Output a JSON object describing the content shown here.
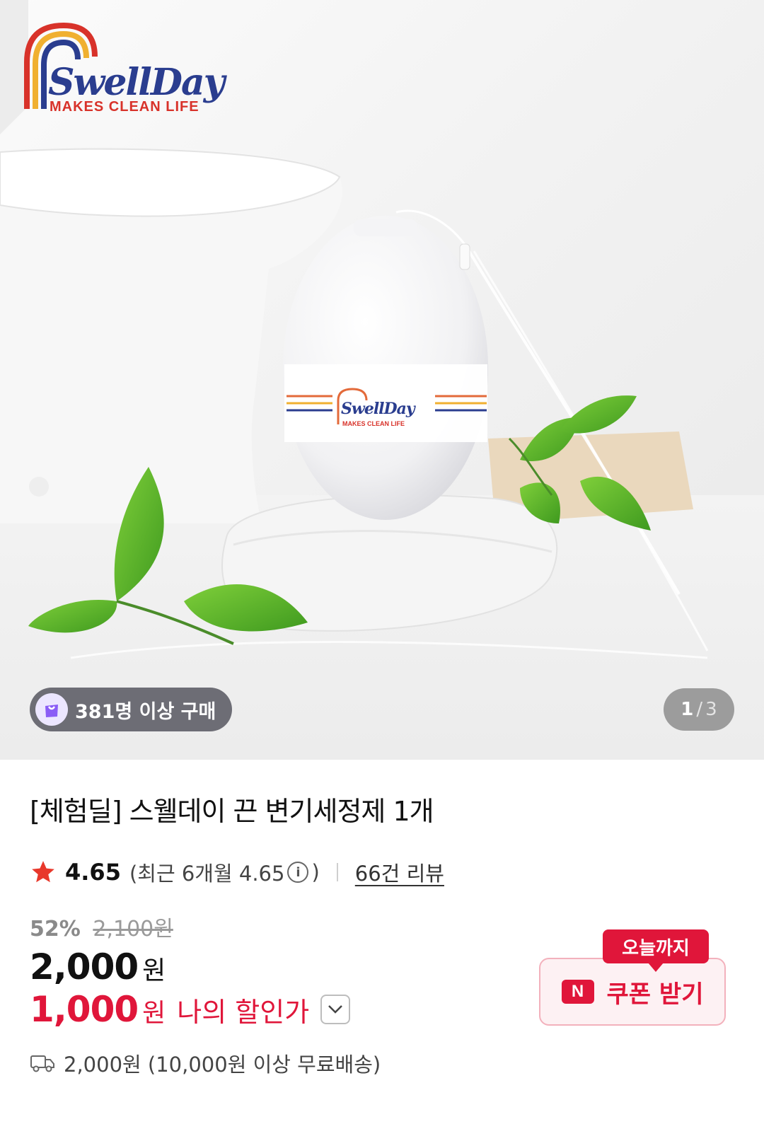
{
  "hero": {
    "logo": {
      "wordmark": "SwellDay",
      "tagline": "MAKES CLEAN LIFE"
    },
    "product_label": {
      "wordmark": "SwellDay",
      "tagline": "MAKES CLEAN LIFE"
    },
    "buyers_badge": "381명 이상 구매",
    "pager": {
      "current": "1",
      "separator": "/",
      "total": "3"
    }
  },
  "product": {
    "title": "[체험딜] 스웰데이 끈 변기세정제 1개",
    "rating": {
      "score": "4.65",
      "recent": "(최근 6개월 4.65",
      "recent_close": ")",
      "reviews": "66건 리뷰"
    },
    "price": {
      "discount_percent": "52%",
      "original": "2,100원",
      "sale": "2,000",
      "currency": "원",
      "my_price": "1,000",
      "my_price_label": "나의 할인가"
    },
    "shipping": "2,000원 (10,000원 이상 무료배송)"
  },
  "coupon": {
    "badge": "오늘까지",
    "logo": "N",
    "label": "쿠폰 받기"
  },
  "colors": {
    "accent": "#e0163a",
    "logo_blue": "#2a3d8f",
    "star": "#e8382b"
  },
  "icons": [
    "star-icon",
    "info-icon",
    "chevron-down-icon",
    "truck-icon",
    "shopping-bag-icon",
    "naver-icon"
  ]
}
